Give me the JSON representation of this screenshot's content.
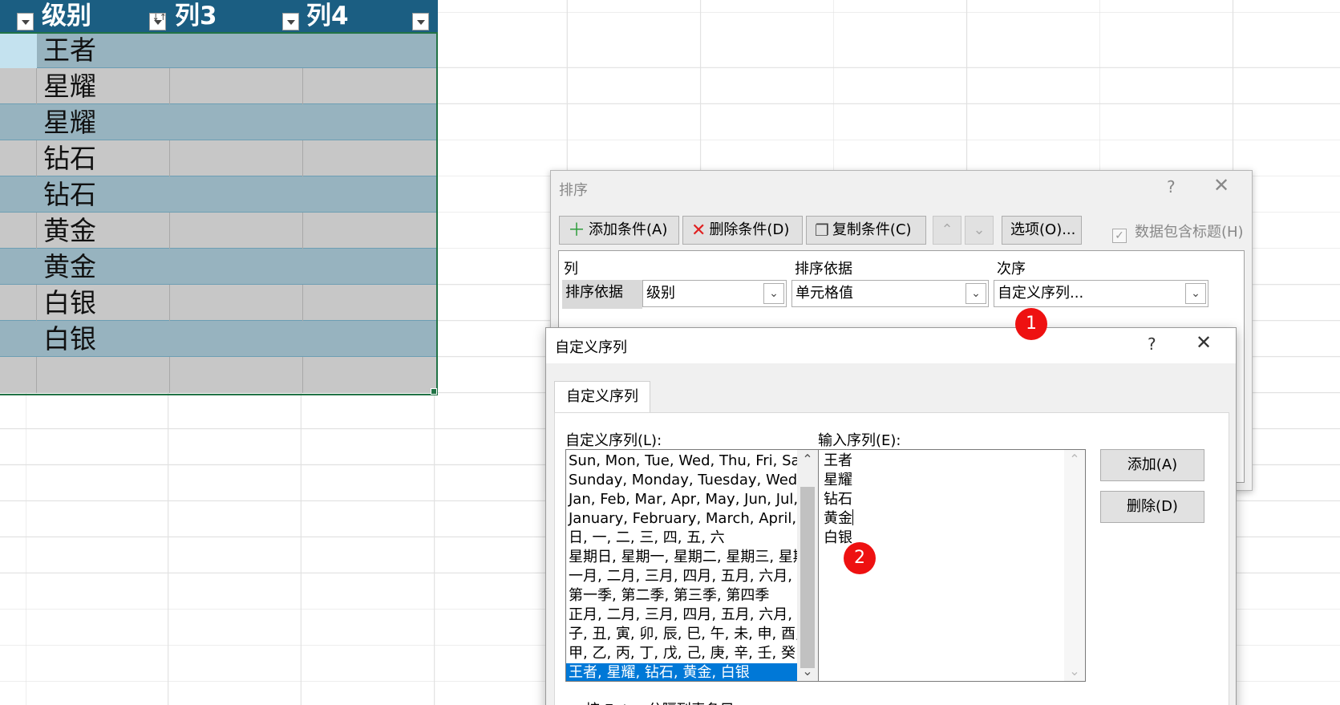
{
  "table": {
    "headers": [
      {
        "label": "级别",
        "filter": "dropdown"
      },
      {
        "label": "列3",
        "filter": "sorted-dropdown"
      },
      {
        "label": "列4",
        "filter": "dropdown"
      }
    ],
    "rows": [
      "王者",
      "星耀",
      "星耀",
      "钻石",
      "钻石",
      "黄金",
      "黄金",
      "白银",
      "白银",
      ""
    ]
  },
  "sort_dialog": {
    "title": "排序",
    "help": "?",
    "close": "✕",
    "toolbar": {
      "add_condition": "添加条件(A)",
      "delete_condition": "删除条件(D)",
      "copy_condition": "复制条件(C)",
      "move_up": "⌃",
      "move_down": "⌄",
      "options": "选项(O)..."
    },
    "has_headers_label": "数据包含标题(H)",
    "has_headers_checked": true,
    "columns": {
      "col": "列",
      "sort_on": "排序依据",
      "order": "次序"
    },
    "row": {
      "label": "排序依据",
      "column_value": "级别",
      "sort_on_value": "单元格值",
      "order_value": "自定义序列..."
    }
  },
  "custom_list_dialog": {
    "title": "自定义序列",
    "help": "?",
    "close": "✕",
    "tab": "自定义序列",
    "lists_label": "自定义序列(L):",
    "entries_label": "输入序列(E):",
    "lists": [
      "Sun, Mon, Tue, Wed, Thu, Fri, Sat",
      "Sunday, Monday, Tuesday, Wednesday, Thursday, Friday, Saturday",
      "Jan, Feb, Mar, Apr, May, Jun, Jul, Aug, Sep, Oct, Nov, Dec",
      "January, February, March, April, May, June, July, August, September, October, November, December",
      "日, 一, 二, 三, 四, 五, 六",
      "星期日, 星期一, 星期二, 星期三, 星期四, 星期五, 星期六",
      "一月, 二月, 三月, 四月, 五月, 六月, 七月, 八月, 九月, 十月, 十一月, 十二月",
      "第一季, 第二季, 第三季, 第四季",
      "正月, 二月, 三月, 四月, 五月, 六月, 七月, 八月, 九月, 十月, 十一月, 腊月",
      "子, 丑, 寅, 卯, 辰, 巳, 午, 未, 申, 酉, 戌, 亥",
      "甲, 乙, 丙, 丁, 戊, 己, 庚, 辛, 壬, 癸",
      "王者, 星耀, 钻石, 黄金, 白银"
    ],
    "selected_list_index": 11,
    "entries": [
      "王者",
      "星耀",
      "钻石",
      "黄金",
      "白银"
    ],
    "add_button": "添加(A)",
    "delete_button": "删除(D)",
    "hint": "按 Enter 分隔列表条目。"
  },
  "badges": [
    "1",
    "2"
  ],
  "colors": {
    "header": "#1b5e82",
    "selection": "#0078d7",
    "badge": "#ee1111"
  }
}
